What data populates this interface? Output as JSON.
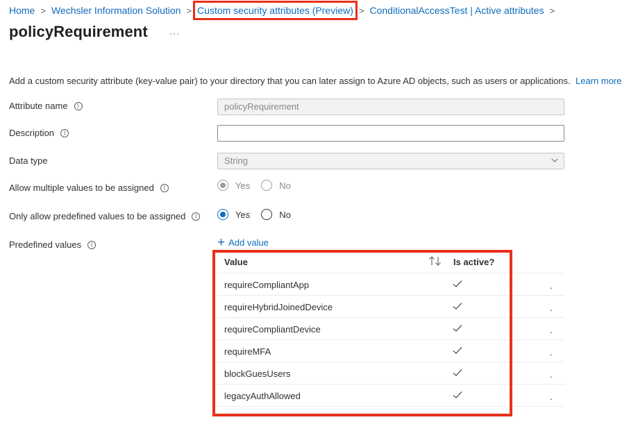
{
  "breadcrumb": {
    "items": [
      "Home",
      "Wechsler Information Solution",
      "Custom security attributes (Preview)",
      "ConditionalAccessTest | Active attributes"
    ],
    "separator": ">"
  },
  "page": {
    "title": "policyRequirement",
    "more_label": "···",
    "description": "Add a custom security attribute (key-value pair) to your directory that you can later assign to Azure AD objects, such as users or applications.",
    "learn_more": "Learn more"
  },
  "form": {
    "attribute_name": {
      "label": "Attribute name",
      "value": "policyRequirement"
    },
    "description": {
      "label": "Description",
      "value": ""
    },
    "data_type": {
      "label": "Data type",
      "value": "String"
    },
    "allow_multiple": {
      "label": "Allow multiple values to be assigned",
      "yes": "Yes",
      "no": "No",
      "selected": "Yes",
      "disabled": true
    },
    "only_predefined": {
      "label": "Only allow predefined values to be assigned",
      "yes": "Yes",
      "no": "No",
      "selected": "Yes"
    },
    "predefined": {
      "label": "Predefined values",
      "add_label": "Add value"
    }
  },
  "table": {
    "headers": {
      "value": "Value",
      "active": "Is active?"
    },
    "rows": [
      {
        "value": "requireCompliantApp",
        "active": true,
        "more": "."
      },
      {
        "value": "requireHybridJoinedDevice",
        "active": true,
        "more": "."
      },
      {
        "value": "requireCompliantDevice",
        "active": true,
        "more": "."
      },
      {
        "value": "requireMFA",
        "active": true,
        "more": "."
      },
      {
        "value": "blockGuesUsers",
        "active": true,
        "more": "."
      },
      {
        "value": "legacyAuthAllowed",
        "active": true,
        "more": "."
      }
    ]
  },
  "colors": {
    "link": "#0f6cbd",
    "highlight": "#e8301b",
    "text": "#323130"
  },
  "icons": [
    "chevron-right-icon",
    "info-icon",
    "chevron-down-icon",
    "plus-icon",
    "sort-icon",
    "checkmark-icon"
  ]
}
